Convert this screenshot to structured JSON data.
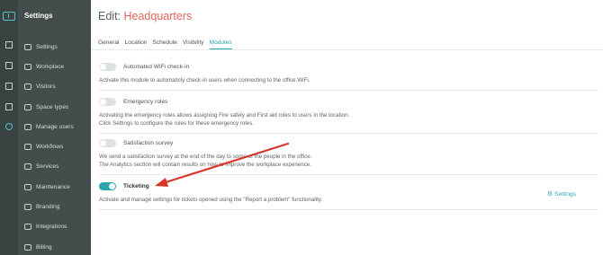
{
  "sidebar": {
    "title": "Settings",
    "items": [
      {
        "label": "Settings",
        "icon": "gear-icon"
      },
      {
        "label": "Workplace",
        "icon": "building-icon"
      },
      {
        "label": "Visitors",
        "icon": "visitor-icon"
      },
      {
        "label": "Space types",
        "icon": "space-icon"
      },
      {
        "label": "Manage users",
        "icon": "users-icon"
      },
      {
        "label": "Workflows",
        "icon": "workflow-icon"
      },
      {
        "label": "Services",
        "icon": "services-icon"
      },
      {
        "label": "Maintenance",
        "icon": "maintenance-icon"
      },
      {
        "label": "Branding",
        "icon": "branding-icon"
      },
      {
        "label": "Integrations",
        "icon": "integrations-icon"
      },
      {
        "label": "Billing",
        "icon": "billing-icon"
      }
    ]
  },
  "header": {
    "prefix": "Edit:",
    "name": "Headquarters"
  },
  "tabs": [
    "General",
    "Location",
    "Schedule",
    "Visibility",
    "Modules"
  ],
  "active_tab": "Modules",
  "modules": [
    {
      "label": "Automated WiFi check-in",
      "enabled": false,
      "desc": [
        "Activate this module to automaticly check-in users when connecting to the office WiFi."
      ]
    },
    {
      "label": "Emergency roles",
      "enabled": false,
      "desc": [
        "Activating the emergency roles allows assigning Fire safety and First aid roles to users in the location.",
        "Click Settings to configure the rules for these emergency roles."
      ]
    },
    {
      "label": "Satisfaction survey",
      "enabled": false,
      "desc": [
        "We send a satisfaction survey at the end of the day to some of the people in the office.",
        "The Analytics section will contain results on how to improve the workplace experience."
      ]
    },
    {
      "label": "Ticketing",
      "enabled": true,
      "desc": [
        "Activate and manage settings for tickets opened using the \"Report a problem\" functionality."
      ]
    }
  ],
  "settings_link": "Settings",
  "colors": {
    "accent": "#2aa6b0",
    "title_name": "#e0645c",
    "arrow": "#d9362b",
    "sidebar": "#444c4c",
    "rail": "#3a4242"
  }
}
